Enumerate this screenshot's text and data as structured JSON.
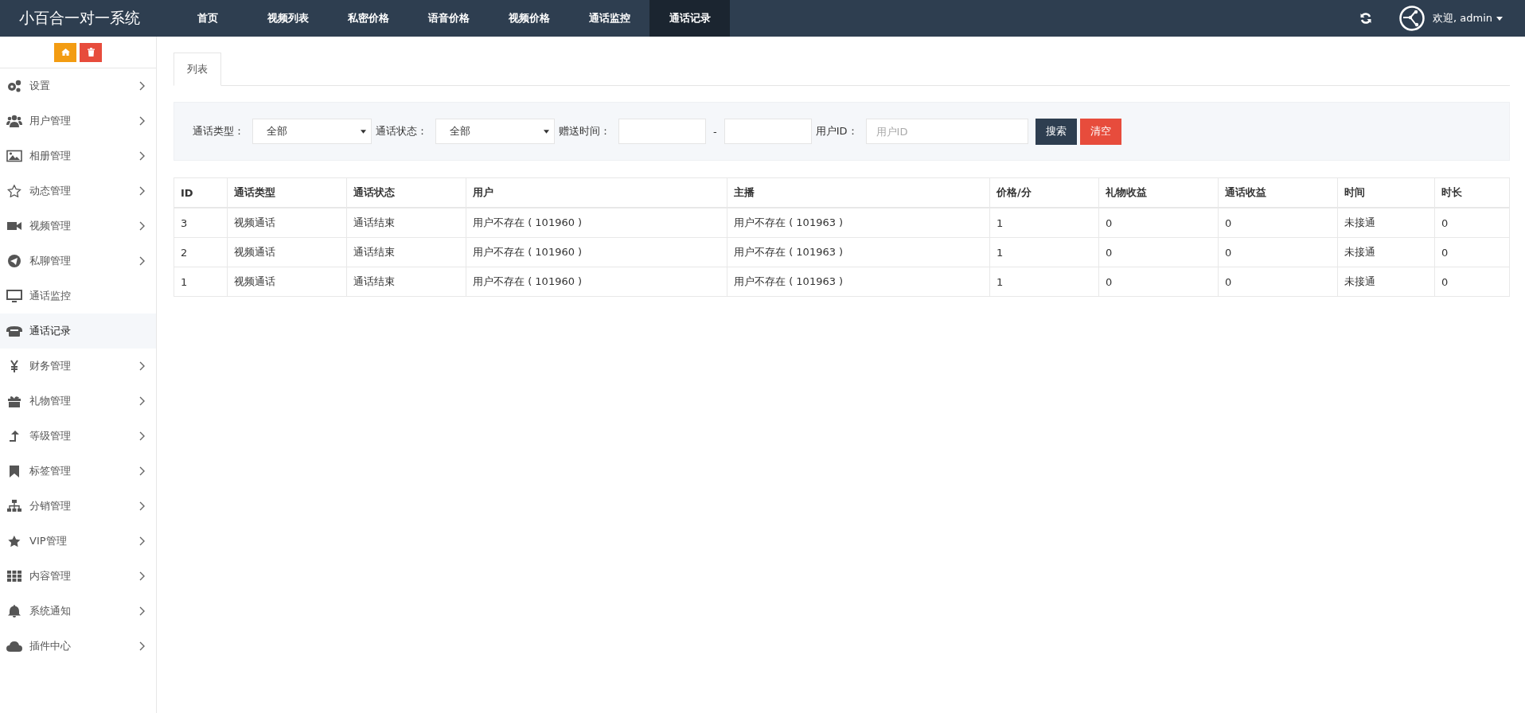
{
  "brand": "小百合一对一系统",
  "nav": [
    {
      "label": "首页",
      "selected": false
    },
    {
      "label": "视频列表",
      "selected": false
    },
    {
      "label": "私密价格",
      "selected": false
    },
    {
      "label": "语音价格",
      "selected": false
    },
    {
      "label": "视频价格",
      "selected": false
    },
    {
      "label": "通话监控",
      "selected": false
    },
    {
      "label": "通话记录",
      "selected": true
    }
  ],
  "header": {
    "welcome": "欢迎, admin"
  },
  "sidebar": {
    "items": [
      {
        "label": "设置",
        "has_submenu": true,
        "selected": false
      },
      {
        "label": "用户管理",
        "has_submenu": true,
        "selected": false
      },
      {
        "label": "相册管理",
        "has_submenu": true,
        "selected": false
      },
      {
        "label": "动态管理",
        "has_submenu": true,
        "selected": false
      },
      {
        "label": "视频管理",
        "has_submenu": true,
        "selected": false
      },
      {
        "label": "私聊管理",
        "has_submenu": true,
        "selected": false
      },
      {
        "label": "通话监控",
        "has_submenu": false,
        "selected": false
      },
      {
        "label": "通话记录",
        "has_submenu": false,
        "selected": true
      },
      {
        "label": "财务管理",
        "has_submenu": true,
        "selected": false
      },
      {
        "label": "礼物管理",
        "has_submenu": true,
        "selected": false
      },
      {
        "label": "等级管理",
        "has_submenu": true,
        "selected": false
      },
      {
        "label": "标签管理",
        "has_submenu": true,
        "selected": false
      },
      {
        "label": "分销管理",
        "has_submenu": true,
        "selected": false
      },
      {
        "label": "VIP管理",
        "has_submenu": true,
        "selected": false
      },
      {
        "label": "内容管理",
        "has_submenu": true,
        "selected": false
      },
      {
        "label": "系统通知",
        "has_submenu": true,
        "selected": false
      },
      {
        "label": "插件中心",
        "has_submenu": true,
        "selected": false
      }
    ]
  },
  "tabs": [
    {
      "label": "列表",
      "selected": true
    }
  ],
  "filters": {
    "call_type": {
      "label": "通话类型：",
      "value": "全部"
    },
    "call_status": {
      "label": "通话状态：",
      "value": "全部"
    },
    "gift_time": {
      "label": "赠送时间：",
      "separator": "-"
    },
    "user_id": {
      "label": "用户ID：",
      "placeholder": "用户ID"
    },
    "buttons": [
      {
        "label": "搜索",
        "kind": "primary"
      },
      {
        "label": "清空",
        "kind": "danger"
      }
    ]
  },
  "table": {
    "columns": [
      "ID",
      "通话类型",
      "通话状态",
      "用户",
      "主播",
      "价格/分",
      "礼物收益",
      "通话收益",
      "时间",
      "时长"
    ],
    "rows": [
      [
        "3",
        "视频通话",
        "通话结束",
        "用户不存在 ( 101960 )",
        "用户不存在 ( 101963 )",
        "1",
        "0",
        "0",
        "未接通",
        "0"
      ],
      [
        "2",
        "视频通话",
        "通话结束",
        "用户不存在 ( 101960 )",
        "用户不存在 ( 101963 )",
        "1",
        "0",
        "0",
        "未接通",
        "0"
      ],
      [
        "1",
        "视频通话",
        "通话结束",
        "用户不存在 ( 101960 )",
        "用户不存在 ( 101963 )",
        "1",
        "0",
        "0",
        "未接通",
        "0"
      ]
    ]
  }
}
